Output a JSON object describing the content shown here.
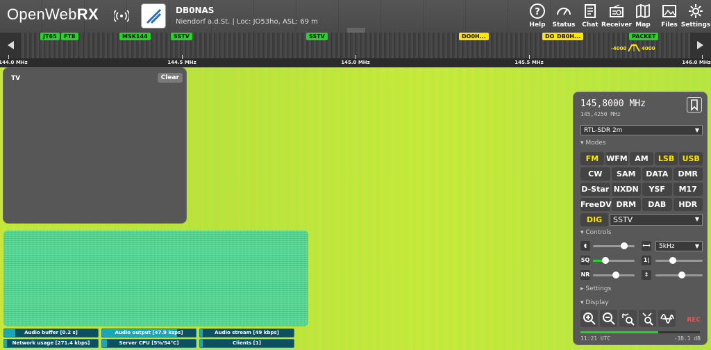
{
  "header": {
    "brand_light": "OpenWeb",
    "brand_bold": "RX",
    "receiver_name": "DB0NAS",
    "receiver_location": "Niendorf a.d.St. | Loc: JO53ho, ASL: 69 m",
    "nav": [
      {
        "label": "Help",
        "icon": "help-icon"
      },
      {
        "label": "Status",
        "icon": "gauge-icon"
      },
      {
        "label": "Chat",
        "icon": "chat-icon"
      },
      {
        "label": "Receiver",
        "icon": "radio-icon"
      },
      {
        "label": "Map",
        "icon": "map-icon"
      },
      {
        "label": "Files",
        "icon": "image-icon"
      },
      {
        "label": "Settings",
        "icon": "gear-icon"
      }
    ]
  },
  "scale": {
    "ticks": [
      "144.0 MHz",
      "144.5 MHz",
      "145.0 MHz",
      "145.5 MHz",
      "146.0 MHz"
    ],
    "markers_green": [
      "JT65",
      "FT8",
      "MSK144",
      "SSTV",
      "SSTV",
      "PACKET"
    ],
    "markers_yellow": [
      "DO0H...",
      "DB0H...",
      "DO"
    ],
    "bandwidth_low": "-4000",
    "bandwidth_high": "4000"
  },
  "tv": {
    "title": "TV",
    "clear_label": "Clear"
  },
  "status": [
    {
      "label": "Audio buffer [0.2 s]",
      "level": 0.12
    },
    {
      "label": "Audio output [47.9 ksps]",
      "level": 0.8
    },
    {
      "label": "Audio stream [49 kbps]",
      "level": 0.03
    },
    {
      "label": "Network usage [271.4 kbps]",
      "level": 0.03
    },
    {
      "label": "Server CPU [5%/54°C]",
      "level": 0.05
    },
    {
      "label": "Clients [1]",
      "level": 0.03
    }
  ],
  "receiver": {
    "frequency": "145,8000 MHz",
    "offset_frequency": "145,4250 MHz",
    "profile": "RTL-SDR 2m",
    "modes_section": "▾ Modes",
    "modes": [
      [
        "FM",
        "WFM",
        "AM",
        "LSB",
        "USB"
      ],
      [
        "CW",
        "SAM",
        "DATA",
        "DMR"
      ],
      [
        "D-Star",
        "NXDN",
        "YSF",
        "M17"
      ],
      [
        "FreeDV",
        "DRM",
        "DAB",
        "HDR"
      ]
    ],
    "active_modes": [
      "FM",
      "LSB",
      "USB"
    ],
    "dig_label": "DIG",
    "dig_mode": "SSTV",
    "controls_section": "▾ Controls",
    "bandwidth": "5kHz",
    "sq_label": "SQ",
    "nr_label": "NR",
    "settings_section": "▸ Settings",
    "display_section": "▾ Display",
    "rec_label": "REC",
    "time": "11:21 UTC",
    "level_db": "-38.1 dB",
    "smeter_level": 0.65,
    "volume_level": 0.75,
    "squelch_level": 0.3,
    "nr_level": 0.55
  },
  "colors": {
    "active_mode": "#ffe500",
    "marker_green": "#27d327",
    "marker_yellow": "#ffe500",
    "status_fill": "#19a6b8",
    "rec": "#ff4c4c"
  }
}
